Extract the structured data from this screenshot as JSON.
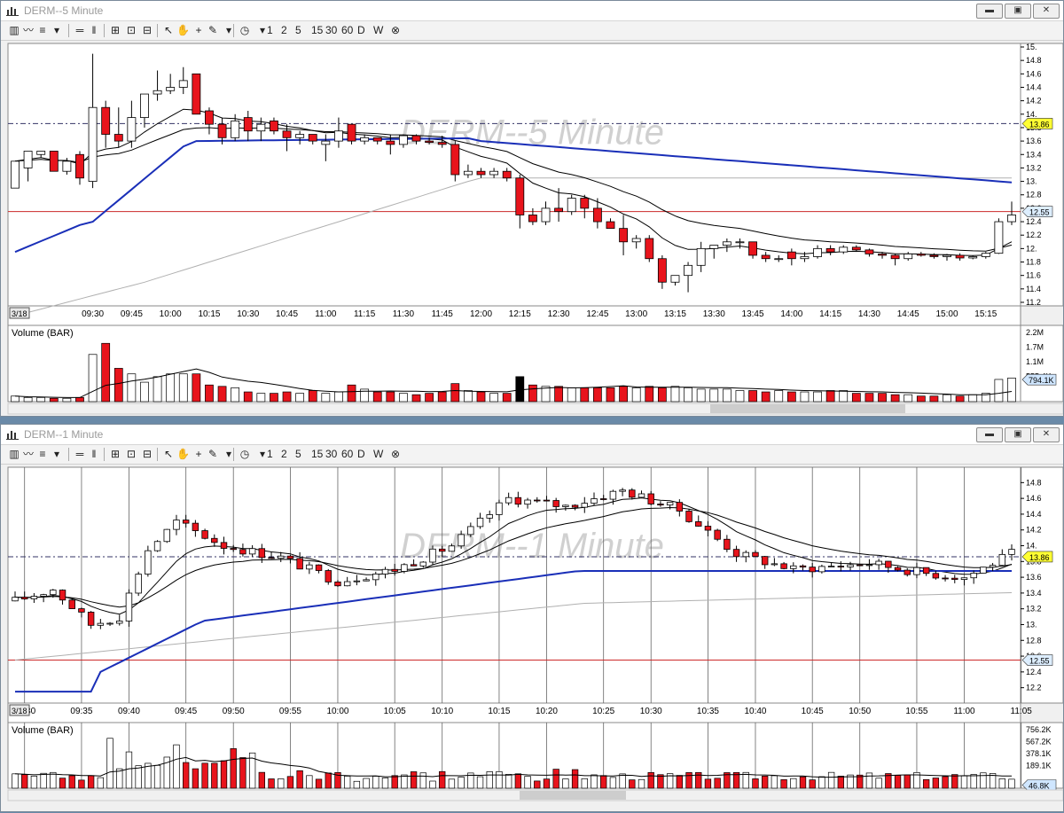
{
  "colors": {
    "up": "#ffffff",
    "down": "#e8141c",
    "wick": "#000000",
    "ma_blue": "#1a2fb8",
    "ma_black": "#000000",
    "ma_gray": "#b0b0b0",
    "level_line": "#cc2a2a",
    "dash_line": "#333366",
    "watermark": "#d0d0d0"
  },
  "toolbar": {
    "icons": [
      "bar-chart-icon",
      "line-chart-icon",
      "chart-style-icon",
      "dropdown-icon",
      "bars-icon",
      "double-bars-icon",
      "zoom-in-icon",
      "zoom-fit-icon",
      "zoom-out-icon",
      "pointer-icon",
      "hand-icon",
      "crosshair-icon",
      "pencil-icon",
      "dropdown-icon",
      "clock-icon",
      "dropdown-icon"
    ],
    "intervals": [
      "1",
      "2",
      "5",
      "15",
      "30",
      "60",
      "D",
      "W"
    ],
    "close": "⊗"
  },
  "windows": [
    {
      "title": "DERM--5 Minute",
      "watermark": "DERM--5 Minute",
      "volume_label": "Volume (BAR)",
      "date_label": "3/18",
      "chart_data": {
        "type": "candlestick",
        "title": "DERM--5 Minute",
        "ylim": [
          11.2,
          15.0
        ],
        "y_ticks": [
          "15.",
          "14.8",
          "14.6",
          "14.4",
          "14.2",
          "14.",
          "13.8",
          "13.6",
          "13.4",
          "13.2",
          "13.",
          "12.8",
          "12.6",
          "12.4",
          "12.2",
          "12.",
          "11.8",
          "11.6",
          "11.4",
          "11.2"
        ],
        "x_ticks": [
          "09:30",
          "09:45",
          "10:00",
          "10:15",
          "10:30",
          "10:45",
          "11:00",
          "11:15",
          "11:30",
          "11:45",
          "12:00",
          "12:15",
          "12:30",
          "12:45",
          "13:00",
          "13:15",
          "13:30",
          "13:45",
          "14:00",
          "14:15",
          "14:30",
          "14:45",
          "15:00",
          "15:15"
        ],
        "price_labels": [
          {
            "value": 13.86,
            "text": "13.86",
            "style": "yellow"
          },
          {
            "value": 12.55,
            "text": "12.55",
            "style": "blue"
          }
        ],
        "hline_dash": 13.86,
        "hline_red": 12.55,
        "ohlc": [
          [
            12.9,
            13.3,
            12.9,
            13.3
          ],
          [
            13.2,
            13.45,
            13.0,
            13.45
          ],
          [
            13.4,
            13.45,
            13.35,
            13.45
          ],
          [
            13.45,
            13.45,
            13.2,
            13.15
          ],
          [
            13.15,
            13.35,
            13.1,
            13.3
          ],
          [
            13.4,
            13.45,
            12.95,
            13.05
          ],
          [
            13.0,
            14.9,
            12.9,
            14.1
          ],
          [
            14.1,
            14.2,
            13.5,
            13.7
          ],
          [
            13.7,
            14.1,
            13.5,
            13.6
          ],
          [
            13.6,
            14.2,
            13.5,
            13.95
          ],
          [
            13.95,
            14.3,
            13.8,
            14.3
          ],
          [
            14.3,
            14.65,
            14.2,
            14.35
          ],
          [
            14.35,
            14.6,
            14.3,
            14.4
          ],
          [
            14.4,
            14.7,
            14.3,
            14.5
          ],
          [
            14.6,
            14.6,
            14.05,
            14.0
          ],
          [
            14.05,
            14.1,
            13.7,
            13.85
          ],
          [
            13.85,
            13.95,
            13.55,
            13.65
          ],
          [
            13.65,
            14.0,
            13.6,
            13.9
          ],
          [
            13.95,
            14.05,
            13.6,
            13.75
          ],
          [
            13.75,
            13.95,
            13.6,
            13.85
          ],
          [
            13.9,
            13.95,
            13.7,
            13.75
          ],
          [
            13.75,
            13.85,
            13.45,
            13.65
          ],
          [
            13.65,
            13.75,
            13.55,
            13.7
          ],
          [
            13.7,
            13.7,
            13.55,
            13.6
          ],
          [
            13.55,
            13.7,
            13.3,
            13.6
          ],
          [
            13.6,
            13.95,
            13.5,
            13.75
          ],
          [
            13.85,
            13.85,
            13.55,
            13.6
          ],
          [
            13.6,
            13.7,
            13.55,
            13.65
          ],
          [
            13.65,
            13.65,
            13.55,
            13.6
          ],
          [
            13.6,
            13.7,
            13.4,
            13.55
          ],
          [
            13.55,
            13.7,
            13.5,
            13.68
          ],
          [
            13.68,
            13.7,
            13.55,
            13.6
          ],
          [
            13.6,
            13.65,
            13.55,
            13.58
          ],
          [
            13.58,
            13.68,
            13.5,
            13.55
          ],
          [
            13.55,
            13.6,
            13.0,
            13.1
          ],
          [
            13.1,
            13.25,
            13.05,
            13.15
          ],
          [
            13.15,
            13.2,
            13.05,
            13.1
          ],
          [
            13.1,
            13.2,
            13.05,
            13.15
          ],
          [
            13.15,
            13.2,
            13.0,
            13.05
          ],
          [
            13.05,
            13.1,
            12.3,
            12.5
          ],
          [
            12.5,
            12.6,
            12.35,
            12.4
          ],
          [
            12.4,
            12.7,
            12.35,
            12.6
          ],
          [
            12.6,
            12.9,
            12.4,
            12.55
          ],
          [
            12.55,
            12.8,
            12.5,
            12.75
          ],
          [
            12.75,
            12.8,
            12.45,
            12.6
          ],
          [
            12.6,
            12.75,
            12.3,
            12.4
          ],
          [
            12.4,
            12.45,
            12.3,
            12.3
          ],
          [
            12.3,
            12.5,
            11.9,
            12.1
          ],
          [
            12.1,
            12.2,
            12.0,
            12.15
          ],
          [
            12.15,
            12.2,
            11.8,
            11.85
          ],
          [
            11.85,
            11.9,
            11.4,
            11.5
          ],
          [
            11.5,
            11.6,
            11.45,
            11.6
          ],
          [
            11.6,
            11.8,
            11.35,
            11.75
          ],
          [
            11.75,
            12.1,
            11.65,
            12.0
          ],
          [
            12.0,
            12.05,
            11.85,
            12.05
          ],
          [
            12.05,
            12.15,
            11.95,
            12.1
          ],
          [
            12.1,
            12.15,
            12.0,
            12.1
          ],
          [
            12.1,
            12.1,
            11.85,
            11.9
          ],
          [
            11.9,
            11.95,
            11.8,
            11.85
          ],
          [
            11.85,
            11.9,
            11.8,
            11.85
          ],
          [
            11.95,
            12.0,
            11.75,
            11.85
          ],
          [
            11.85,
            11.95,
            11.8,
            11.88
          ],
          [
            11.88,
            12.05,
            11.85,
            12.0
          ],
          [
            12.0,
            12.05,
            11.9,
            11.95
          ],
          [
            11.95,
            12.05,
            11.92,
            12.02
          ],
          [
            12.02,
            12.05,
            11.95,
            11.98
          ],
          [
            11.98,
            12.0,
            11.88,
            11.92
          ],
          [
            11.92,
            11.95,
            11.85,
            11.9
          ],
          [
            11.9,
            11.92,
            11.75,
            11.85
          ],
          [
            11.85,
            11.95,
            11.82,
            11.92
          ],
          [
            11.92,
            11.95,
            11.88,
            11.9
          ],
          [
            11.9,
            11.93,
            11.85,
            11.88
          ],
          [
            11.88,
            11.92,
            11.82,
            11.9
          ],
          [
            11.9,
            11.93,
            11.82,
            11.86
          ],
          [
            11.86,
            11.9,
            11.84,
            11.88
          ],
          [
            11.88,
            11.95,
            11.85,
            11.93
          ],
          [
            11.93,
            12.45,
            11.92,
            12.4
          ],
          [
            12.4,
            12.7,
            12.35,
            12.5
          ]
        ],
        "volume": {
          "ylim": [
            0,
            2.3
          ],
          "y_ticks": [
            "2.2M",
            "1.7M",
            "1.1M",
            "555.4K"
          ],
          "labels": [
            {
              "value": 0.794,
              "text": "794.1K",
              "style": "blue"
            }
          ],
          "values": [
            0.2,
            0.15,
            0.15,
            0.12,
            0.12,
            0.15,
            1.7,
            2.1,
            1.2,
            1.0,
            0.7,
            0.9,
            1.0,
            1.0,
            1.0,
            0.6,
            0.55,
            0.5,
            0.35,
            0.3,
            0.3,
            0.35,
            0.3,
            0.4,
            0.3,
            0.35,
            0.6,
            0.45,
            0.35,
            0.35,
            0.3,
            0.25,
            0.3,
            0.35,
            0.65,
            0.4,
            0.35,
            0.3,
            0.3,
            0.9,
            0.6,
            0.55,
            0.55,
            0.5,
            0.5,
            0.5,
            0.5,
            0.55,
            0.5,
            0.55,
            0.5,
            0.55,
            0.5,
            0.45,
            0.45,
            0.45,
            0.4,
            0.4,
            0.35,
            0.4,
            0.35,
            0.35,
            0.35,
            0.4,
            0.4,
            0.3,
            0.3,
            0.3,
            0.25,
            0.25,
            0.2,
            0.2,
            0.25,
            0.2,
            0.25,
            0.3,
            0.8,
            0.85
          ],
          "black_index": [
            39
          ]
        }
      }
    },
    {
      "title": "DERM--1 Minute",
      "watermark": "DERM--1 Minute",
      "volume_label": "Volume (BAR)",
      "date_label": "3/18",
      "chart_data": {
        "type": "candlestick",
        "title": "DERM--1 Minute",
        "ylim": [
          12.05,
          14.95
        ],
        "y_ticks": [
          "14.8",
          "14.6",
          "14.4",
          "14.2",
          "14.",
          "13.8",
          "13.6",
          "13.4",
          "13.2",
          "13.",
          "12.8",
          "12.6",
          "12.4",
          "12.2"
        ],
        "x_ticks": [
          "09:30",
          "09:35",
          "09:40",
          "09:45",
          "09:50",
          "09:55",
          "10:00",
          "10:05",
          "10:10",
          "10:15",
          "10:20",
          "10:25",
          "10:30",
          "10:35",
          "10:40",
          "10:45",
          "10:50",
          "10:55",
          "11:00",
          "11:05"
        ],
        "price_labels": [
          {
            "value": 13.86,
            "text": "13.86",
            "style": "yellow"
          },
          {
            "value": 12.55,
            "text": "12.55",
            "style": "blue"
          }
        ],
        "hline_dash": 13.86,
        "hline_red": 12.55,
        "volume": {
          "ylim": [
            0,
            0.8
          ],
          "y_ticks": [
            "756.2K",
            "567.2K",
            "378.1K",
            "189.1K"
          ],
          "labels": [
            {
              "value": 0.0468,
              "text": "46.8K",
              "style": "blue"
            }
          ]
        }
      }
    }
  ]
}
